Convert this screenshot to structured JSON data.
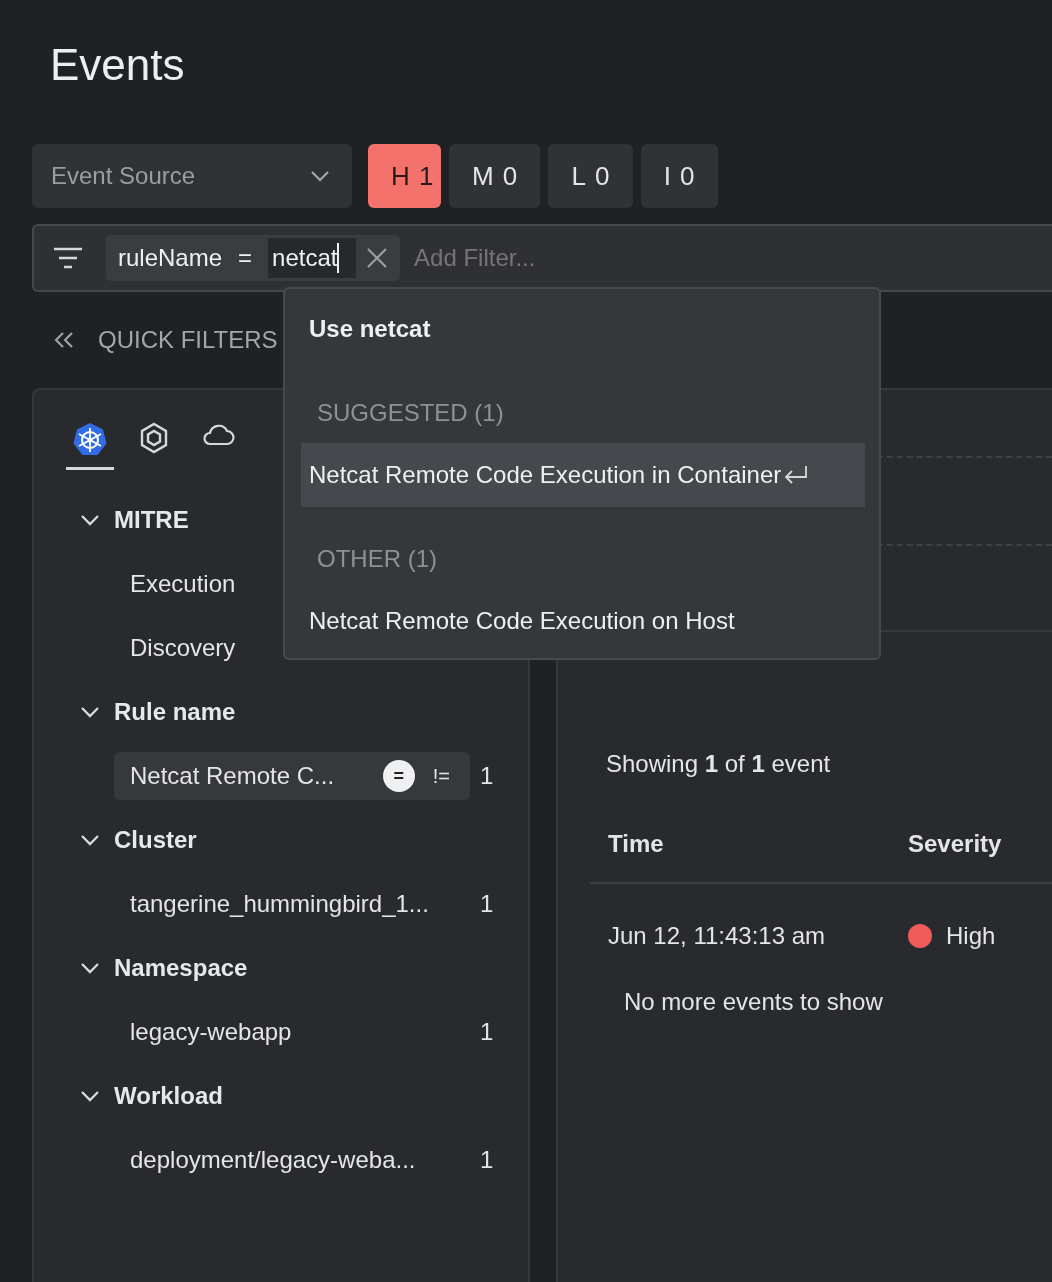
{
  "title": "Events",
  "event_source": {
    "placeholder": "Event Source"
  },
  "severity_buttons": [
    {
      "label": "H1",
      "selected": true
    },
    {
      "label": "M0",
      "selected": false
    },
    {
      "label": "L0",
      "selected": false
    },
    {
      "label": "I0",
      "selected": false
    }
  ],
  "filter_bar": {
    "chip": {
      "field": "ruleName",
      "operator": "=",
      "value": "netcat"
    },
    "placeholder": "Add Filter..."
  },
  "quick_filters": {
    "label": "QUICK FILTERS"
  },
  "source_tabs": [
    {
      "kind": "kubernetes",
      "selected": true
    },
    {
      "kind": "hexagon",
      "selected": false
    },
    {
      "kind": "cloud",
      "selected": false
    }
  ],
  "groups": [
    {
      "title": "MITRE",
      "expanded": true,
      "items": [
        {
          "label": "Execution",
          "selected": false
        },
        {
          "label": "Discovery",
          "selected": false
        }
      ]
    },
    {
      "title": "Rule name",
      "expanded": true,
      "items": [
        {
          "label": "Netcat Remote C...",
          "selected": true,
          "count": "1",
          "equals": "=",
          "not_equals": "!="
        }
      ]
    },
    {
      "title": "Cluster",
      "expanded": true,
      "items": [
        {
          "label": "tangerine_hummingbird_1...",
          "selected": false,
          "count": "1"
        }
      ]
    },
    {
      "title": "Namespace",
      "expanded": true,
      "items": [
        {
          "label": "legacy-webapp",
          "selected": false,
          "count": "1"
        }
      ]
    },
    {
      "title": "Workload",
      "expanded": true,
      "items": [
        {
          "label": "deployment/legacy-weba...",
          "selected": false,
          "count": "1"
        }
      ]
    }
  ],
  "results": {
    "summary": "Showing **1** of **1** event",
    "columns": [
      "Time",
      "Severity"
    ],
    "rows": [
      {
        "time": "Jun 12, 11:43:13 am",
        "severity": "High",
        "color": "#ee5c5c"
      }
    ],
    "footer": "No more events to show"
  },
  "suggestions": {
    "use_label": "Use netcat",
    "sections": [
      {
        "header": "SUGGESTED (1)",
        "items": [
          {
            "label": "Netcat Remote Code Execution in Container",
            "selected": true
          }
        ]
      },
      {
        "header": "OTHER (1)",
        "items": [
          {
            "label": "Netcat Remote Code Execution on Host",
            "selected": false
          }
        ]
      }
    ]
  }
}
